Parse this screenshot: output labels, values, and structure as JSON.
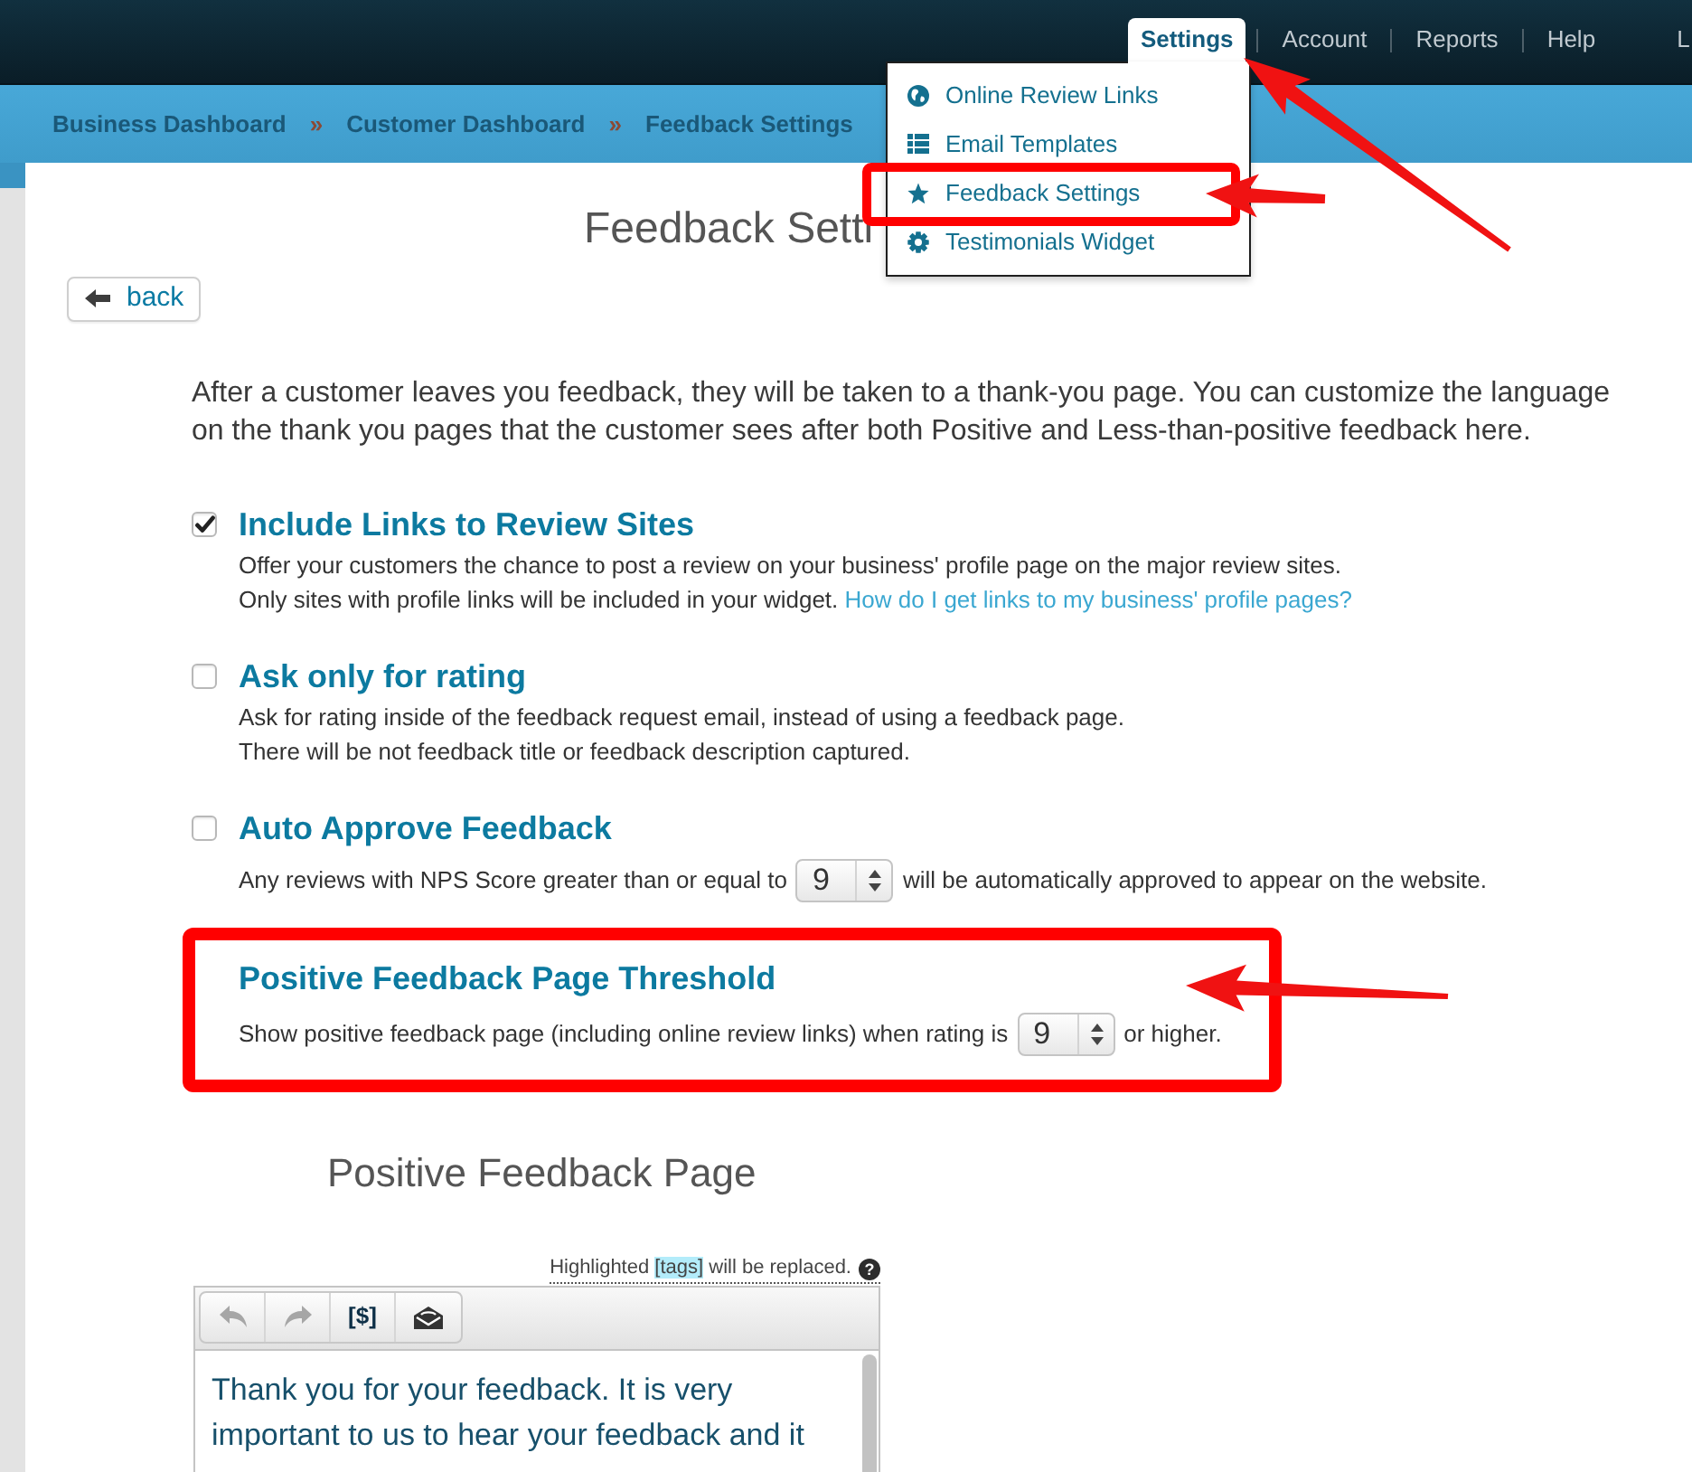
{
  "top_nav": {
    "items": [
      {
        "label": "Settings",
        "selected": true
      },
      {
        "label": "Account",
        "selected": false
      },
      {
        "label": "Reports",
        "selected": false
      },
      {
        "label": "Help",
        "selected": false
      }
    ],
    "user_link": "L"
  },
  "settings_menu": {
    "items": [
      {
        "label": "Online Review Links",
        "annotated": false
      },
      {
        "label": "Email Templates",
        "annotated": false
      },
      {
        "label": "Feedback Settings",
        "annotated": true
      },
      {
        "label": "Testimonials Widget",
        "annotated": false
      }
    ]
  },
  "breadcrumb": {
    "items": [
      "Business Dashboard",
      "Customer Dashboard",
      "Feedback Settings"
    ],
    "separators": [
      "»",
      "»"
    ]
  },
  "page": {
    "title": "Feedback Setti",
    "back_button": "back",
    "intro": "After a customer leaves you feedback, they will be taken to a thank-you page. You can customize the language on the thank you pages that the customer sees after both Positive and Less-than-positive feedback here.",
    "options": [
      {
        "kind": "checkbox",
        "checked": true,
        "title": "Include Links to Review Sites",
        "lines": [
          {
            "text": "Offer your customers the chance to post a review on your business' profile page on the major review sites."
          },
          {
            "text": "Only sites with profile links will be included in your widget.",
            "link": "How do I get links to my business' profile pages?"
          }
        ]
      },
      {
        "kind": "checkbox",
        "checked": false,
        "title": "Ask only for rating",
        "lines": [
          {
            "text": "Ask for rating inside of the feedback request email, instead of using a feedback page."
          },
          {
            "text": "There will be not feedback title or feedback description captured."
          }
        ]
      },
      {
        "kind": "checkbox",
        "checked": false,
        "title": "Auto Approve Feedback",
        "lines": [
          {
            "text": "Any reviews with NPS Score greater than or equal to",
            "select": "9",
            "after": "will be automatically approved to appear on the website."
          }
        ]
      },
      {
        "kind": "plain",
        "annotated": true,
        "title": "Positive Feedback Page Threshold",
        "lines": [
          {
            "text": "Show positive feedback page (including online review links) when rating is",
            "select": "9",
            "after": "or higher."
          }
        ]
      }
    ]
  },
  "positive_page": {
    "heading": "Positive Feedback Page",
    "tags_note": {
      "before": "Highlighted",
      "tag": "[tags]",
      "after": "will be replaced.",
      "help": "?"
    },
    "editor": {
      "toolbar": [
        {
          "disabled": true
        },
        {
          "disabled": true
        },
        {
          "label": "[$]",
          "disabled": false
        },
        {
          "disabled": false
        }
      ],
      "text": "Thank you for your feedback. It is very important to us to hear your feedback and it"
    }
  }
}
